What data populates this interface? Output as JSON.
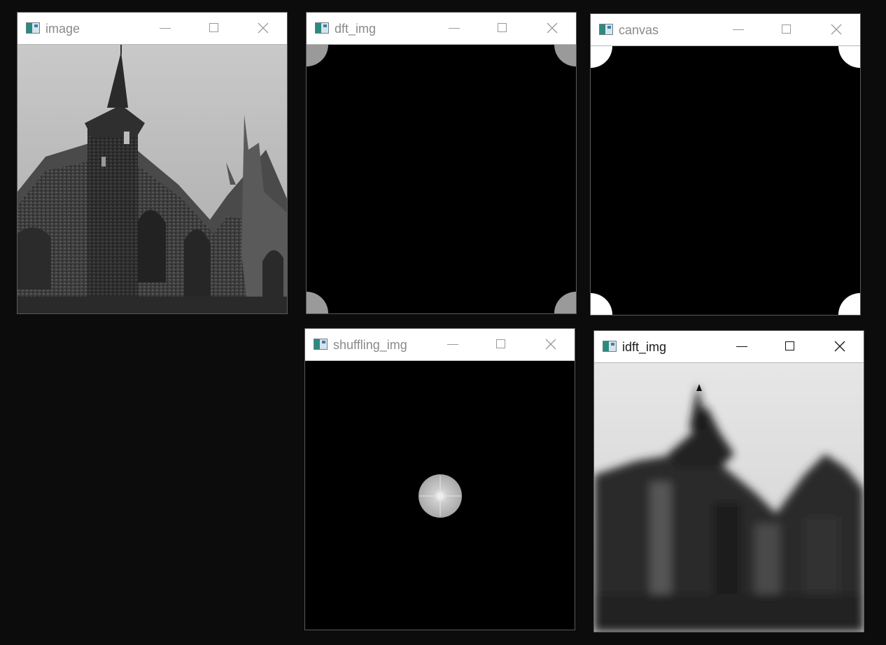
{
  "windows": {
    "image": {
      "title": "image"
    },
    "dft_img": {
      "title": "dft_img"
    },
    "canvas": {
      "title": "canvas"
    },
    "shuffling_img": {
      "title": "shuffling_img"
    },
    "idft_img": {
      "title": "idft_img"
    }
  },
  "colors": {
    "desktop_background": "#0c0c0c",
    "titlebar": "#ffffff",
    "inactive_title_text": "#8a8a8a",
    "active_title_text": "#1a1a1a",
    "image_content": "#000000"
  },
  "icons": {
    "window_icon": "opencv-window-icon",
    "minimize": "minimize-icon",
    "maximize": "maximize-icon",
    "close": "close-icon"
  }
}
